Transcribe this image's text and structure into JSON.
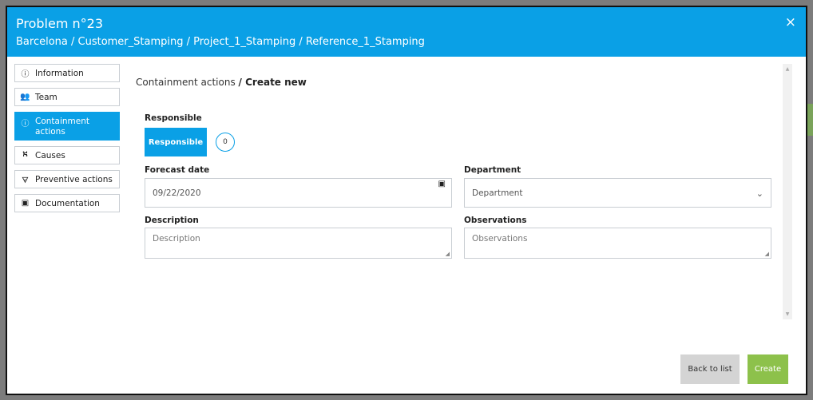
{
  "header": {
    "title": "Problem n°23",
    "path": "Barcelona / Customer_Stamping / Project_1_Stamping / Reference_1_Stamping",
    "close": "×"
  },
  "sidebar": {
    "items": [
      {
        "label": "Information",
        "icon": "info-circle-icon",
        "glyph": "ⓘ"
      },
      {
        "label": "Team",
        "icon": "team-icon",
        "glyph": "👥"
      },
      {
        "label": "Containment actions",
        "icon": "info-circle-icon",
        "glyph": "ⓘ"
      },
      {
        "label": "Causes",
        "icon": "causes-tree-icon",
        "glyph": "⛕"
      },
      {
        "label": "Preventive actions",
        "icon": "preventive-icon",
        "glyph": "🜃"
      },
      {
        "label": "Documentation",
        "icon": "document-icon",
        "glyph": "▣"
      }
    ]
  },
  "breadcrumb": {
    "section": "Containment actions",
    "current": "/ Create new"
  },
  "responsible": {
    "label": "Responsible",
    "button": "Responsible",
    "count": "0"
  },
  "forecast": {
    "label": "Forecast date",
    "value": "09/22/2020"
  },
  "department": {
    "label": "Department",
    "placeholder": "Department"
  },
  "description": {
    "label": "Description",
    "placeholder": "Description"
  },
  "observations": {
    "label": "Observations",
    "placeholder": "Observations"
  },
  "actions": {
    "back": "Back to list",
    "create": "Create"
  },
  "colors": {
    "primary": "#0aa0e6",
    "create": "#8dc14b",
    "back": "#d4d4d4"
  }
}
